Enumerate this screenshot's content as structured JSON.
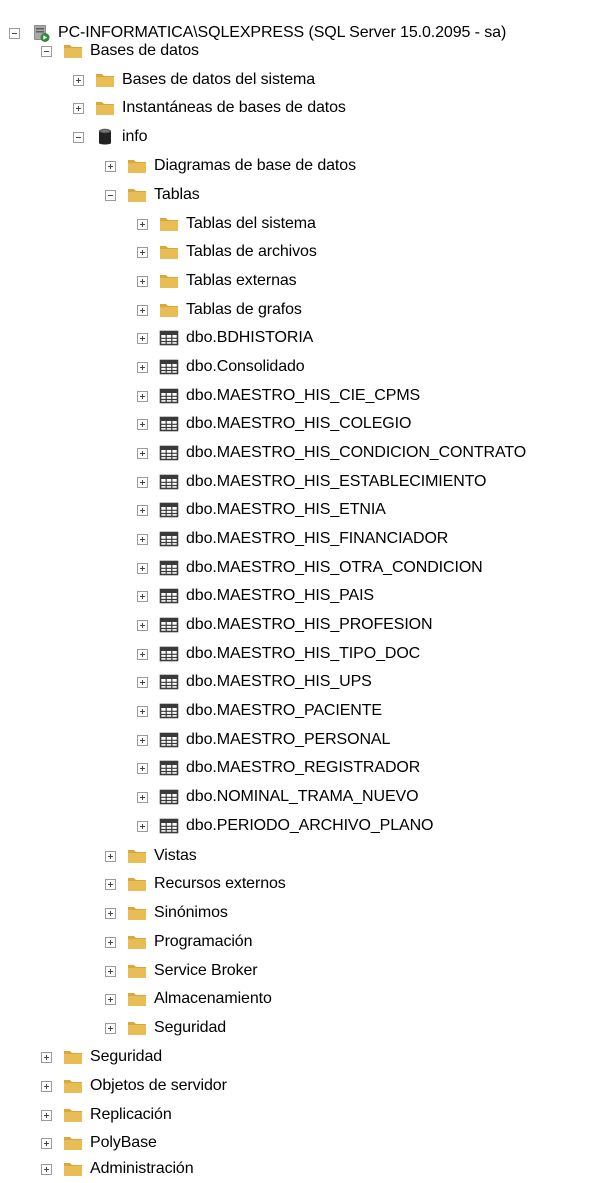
{
  "colors": {
    "folder": "#e8bd55",
    "folder_dark": "#d9a73a",
    "table_border": "#3a3a3a",
    "expander_border": "#9b9b9b",
    "server_green": "#2e8b3a",
    "server_gray": "#6b6b6b"
  },
  "tree": {
    "server": {
      "label": "PC-INFORMATICA\\SQLEXPRESS (SQL Server 15.0.2095 - sa)",
      "icon": "server-icon",
      "expanded": true
    },
    "databases": {
      "label": "Bases de datos",
      "icon": "folder-icon",
      "expanded": true
    },
    "system_databases": {
      "label": "Bases de datos del sistema",
      "icon": "folder-icon",
      "expanded": false
    },
    "snapshots": {
      "label": "Instantáneas de bases de datos",
      "icon": "folder-icon",
      "expanded": false
    },
    "db_info": {
      "label": "info",
      "icon": "database-icon",
      "expanded": true,
      "diagrams": {
        "label": "Diagramas de base de datos"
      },
      "tables": {
        "label": "Tablas",
        "expanded": true,
        "system_tables": {
          "label": "Tablas del sistema"
        },
        "file_tables": {
          "label": "Tablas de archivos"
        },
        "external_tables": {
          "label": "Tablas externas"
        },
        "graph_tables": {
          "label": "Tablas de grafos"
        },
        "items": [
          "dbo.BDHISTORIA",
          "dbo.Consolidado",
          "dbo.MAESTRO_HIS_CIE_CPMS",
          "dbo.MAESTRO_HIS_COLEGIO",
          "dbo.MAESTRO_HIS_CONDICION_CONTRATO",
          "dbo.MAESTRO_HIS_ESTABLECIMIENTO",
          "dbo.MAESTRO_HIS_ETNIA",
          "dbo.MAESTRO_HIS_FINANCIADOR",
          "dbo.MAESTRO_HIS_OTRA_CONDICION",
          "dbo.MAESTRO_HIS_PAIS",
          "dbo.MAESTRO_HIS_PROFESION",
          "dbo.MAESTRO_HIS_TIPO_DOC",
          "dbo.MAESTRO_HIS_UPS",
          "dbo.MAESTRO_PACIENTE",
          "dbo.MAESTRO_PERSONAL",
          "dbo.MAESTRO_REGISTRADOR",
          "dbo.NOMINAL_TRAMA_NUEVO",
          "dbo.PERIODO_ARCHIVO_PLANO"
        ]
      },
      "views": {
        "label": "Vistas"
      },
      "external_resources": {
        "label": "Recursos externos"
      },
      "synonyms": {
        "label": "Sinónimos"
      },
      "programmability": {
        "label": "Programación"
      },
      "service_broker": {
        "label": "Service Broker"
      },
      "storage": {
        "label": "Almacenamiento"
      },
      "db_security": {
        "label": "Seguridad"
      }
    },
    "security": {
      "label": "Seguridad"
    },
    "server_objects": {
      "label": "Objetos de servidor"
    },
    "replication": {
      "label": "Replicación"
    },
    "polybase": {
      "label": "PolyBase"
    },
    "management": {
      "label": "Administración"
    }
  }
}
